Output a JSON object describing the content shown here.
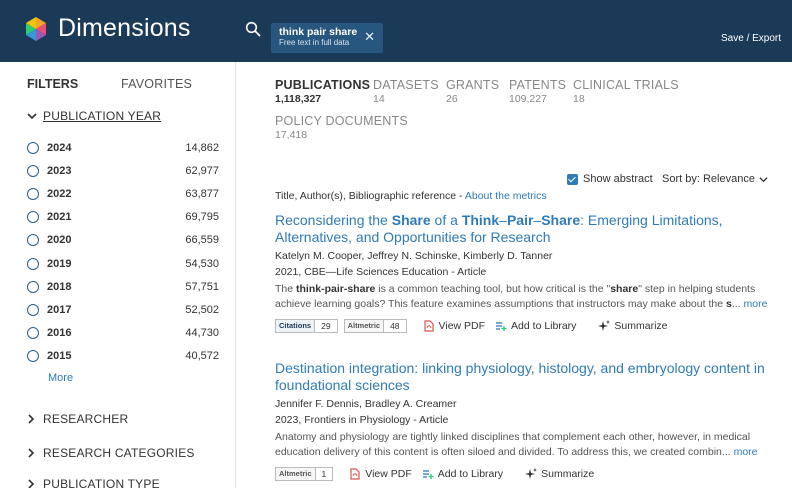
{
  "header": {
    "app_name": "Dimensions",
    "search_query": "think pair share",
    "search_scope": "Free text in full data",
    "save_export": "Save / Export"
  },
  "sidebar": {
    "tab_filters": "FILTERS",
    "tab_favorites": "FAVORITES",
    "year_facet_title": "PUBLICATION YEAR",
    "years": [
      {
        "year": "2024",
        "count": "14,862"
      },
      {
        "year": "2023",
        "count": "62,977"
      },
      {
        "year": "2022",
        "count": "63,877"
      },
      {
        "year": "2021",
        "count": "69,795"
      },
      {
        "year": "2020",
        "count": "66,559"
      },
      {
        "year": "2019",
        "count": "54,530"
      },
      {
        "year": "2018",
        "count": "57,751"
      },
      {
        "year": "2017",
        "count": "52,502"
      },
      {
        "year": "2016",
        "count": "44,730"
      },
      {
        "year": "2015",
        "count": "40,572"
      }
    ],
    "more": "More",
    "facets": [
      "RESEARCHER",
      "RESEARCH CATEGORIES",
      "PUBLICATION TYPE"
    ]
  },
  "tabs": {
    "publications": {
      "label": "PUBLICATIONS",
      "count": "1,118,327"
    },
    "datasets": {
      "label": "DATASETS",
      "count": "14"
    },
    "grants": {
      "label": "GRANTS",
      "count": "26"
    },
    "patents": {
      "label": "PATENTS",
      "count": "109,227"
    },
    "clinical_trials": {
      "label": "CLINICAL TRIALS",
      "count": "18"
    },
    "policy_documents": {
      "label": "POLICY DOCUMENTS",
      "count": "17,418"
    }
  },
  "controls": {
    "show_abstract": "Show abstract",
    "sort_by": "Sort by: Relevance"
  },
  "reference_line": {
    "text": "Title, Author(s), Bibliographic reference - ",
    "link": "About the metrics"
  },
  "results": [
    {
      "title_parts": [
        "Reconsidering the ",
        "Share",
        " of a ",
        "Think",
        "–",
        "Pair",
        "–",
        "Share",
        ": Emerging Limitations, Alternatives, and Opportunities for Research"
      ],
      "authors": "Katelyn M. Cooper, Jeffrey N. Schinske, Kimberly D. Tanner",
      "meta": "2021, CBE—Life Sciences Education - Article",
      "abstract_parts": [
        "The ",
        "think-pair-share",
        " is a common teaching tool, but how critical is the \"",
        "share",
        "\" step in helping students achieve learning goals? This feature examines assumptions that instructors may make about the ",
        "s",
        "..."
      ],
      "more": "more",
      "citations_label": "Citations",
      "citations": "29",
      "altmetric_label": "Altmetric",
      "altmetric": "48",
      "view_pdf": "View PDF",
      "add_library": "Add to Library",
      "summarize": "Summarize"
    },
    {
      "title": "Destination integration: linking physiology, histology, and embryology content in foundational sciences",
      "authors": "Jennifer F. Dennis, Bradley A. Creamer",
      "meta": "2023, Frontiers in Physiology - Article",
      "abstract": "Anatomy and physiology are tightly linked disciplines that complement each other, however, in medical education delivery of this content is often siloed and divided. To address this, we created combin...",
      "more": "more",
      "altmetric_label": "Altmetric",
      "altmetric": "1",
      "view_pdf": "View PDF",
      "add_library": "Add to Library",
      "summarize": "Summarize"
    }
  ],
  "colors": {
    "header_bg": "#1b3a57",
    "chip_bg": "#27577e",
    "link": "#2f7bb8",
    "radio": "#2b5d88"
  }
}
